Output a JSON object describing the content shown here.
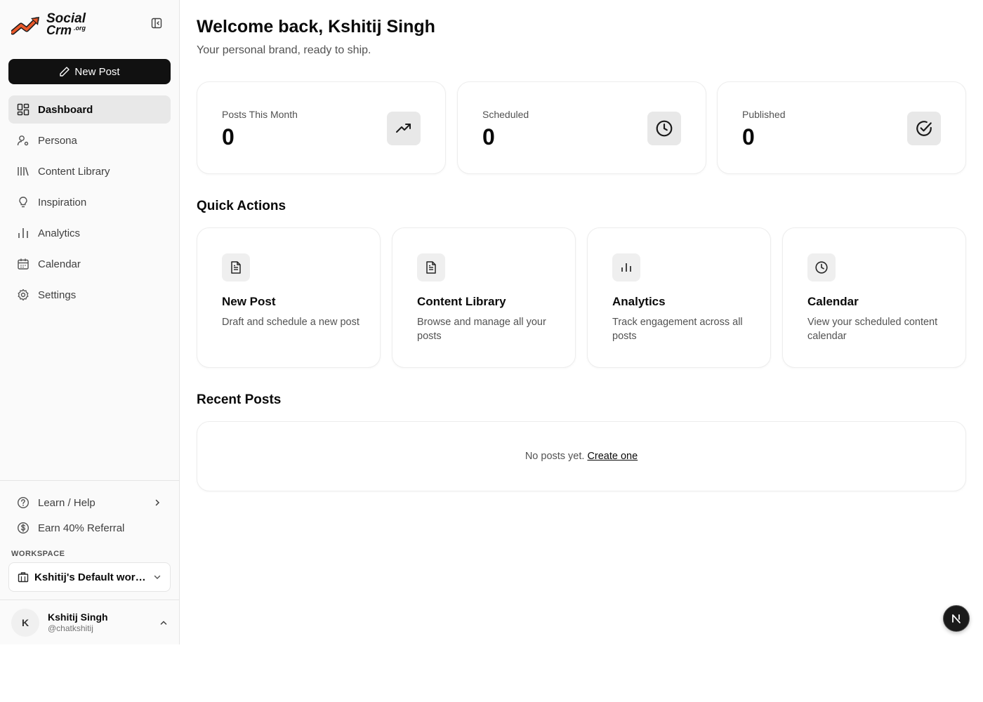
{
  "brand": {
    "line1": "Social",
    "line2": "Crm",
    "suffix": ".org"
  },
  "sidebar": {
    "new_post_label": "New Post",
    "items": [
      {
        "label": "Dashboard",
        "icon": "dashboard-icon",
        "active": true
      },
      {
        "label": "Persona",
        "icon": "user-cog-icon"
      },
      {
        "label": "Content Library",
        "icon": "library-icon"
      },
      {
        "label": "Inspiration",
        "icon": "lightbulb-icon"
      },
      {
        "label": "Analytics",
        "icon": "bar-chart-icon"
      },
      {
        "label": "Calendar",
        "icon": "calendar-icon"
      },
      {
        "label": "Settings",
        "icon": "gear-icon"
      }
    ],
    "help_label": "Learn / Help",
    "referral_label": "Earn 40% Referral",
    "workspace_label": "WORKSPACE",
    "workspace_name": "Kshitij's Default workspace",
    "user": {
      "initial": "K",
      "name": "Kshitij Singh",
      "handle": "@chatkshitij"
    }
  },
  "main": {
    "title": "Welcome back, Kshitij Singh",
    "subtitle": "Your personal brand, ready to ship.",
    "stats": [
      {
        "label": "Posts This Month",
        "value": "0",
        "icon": "trending-up-icon"
      },
      {
        "label": "Scheduled",
        "value": "0",
        "icon": "clock-icon"
      },
      {
        "label": "Published",
        "value": "0",
        "icon": "check-circle-icon"
      }
    ],
    "quick_actions_title": "Quick Actions",
    "quick_actions": [
      {
        "title": "New Post",
        "desc": "Draft and schedule a new post",
        "icon": "document-icon"
      },
      {
        "title": "Content Library",
        "desc": "Browse and manage all your posts",
        "icon": "document-icon"
      },
      {
        "title": "Analytics",
        "desc": "Track engagement across all posts",
        "icon": "bar-chart-icon"
      },
      {
        "title": "Calendar",
        "desc": "View your scheduled content calendar",
        "icon": "clock-icon"
      }
    ],
    "recent_posts_title": "Recent Posts",
    "recent_empty_text": "No posts yet.",
    "recent_create_link": "Create one"
  },
  "fab_letter": "N",
  "colors": {
    "primary": "#111111",
    "sidebar_bg": "#fafafa",
    "active_bg": "#e8e8e8",
    "logo_orange": "#e8582a"
  }
}
